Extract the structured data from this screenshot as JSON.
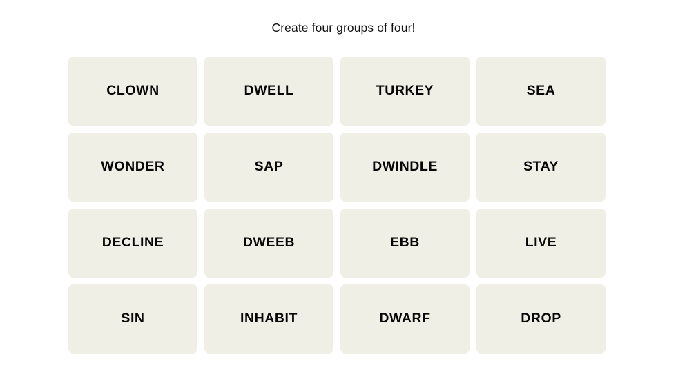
{
  "header": {
    "instruction": "Create four groups of four!"
  },
  "colors": {
    "page_background": "#ffffff",
    "tile_background": "#efefe6",
    "tile_text": "#070707",
    "instruction_text": "#121212"
  },
  "board": {
    "rows": 4,
    "columns": 4,
    "tiles": [
      {
        "label": "CLOWN"
      },
      {
        "label": "DWELL"
      },
      {
        "label": "TURKEY"
      },
      {
        "label": "SEA"
      },
      {
        "label": "WONDER"
      },
      {
        "label": "SAP"
      },
      {
        "label": "DWINDLE"
      },
      {
        "label": "STAY"
      },
      {
        "label": "DECLINE"
      },
      {
        "label": "DWEEB"
      },
      {
        "label": "EBB"
      },
      {
        "label": "LIVE"
      },
      {
        "label": "SIN"
      },
      {
        "label": "INHABIT"
      },
      {
        "label": "DWARF"
      },
      {
        "label": "DROP"
      }
    ]
  }
}
